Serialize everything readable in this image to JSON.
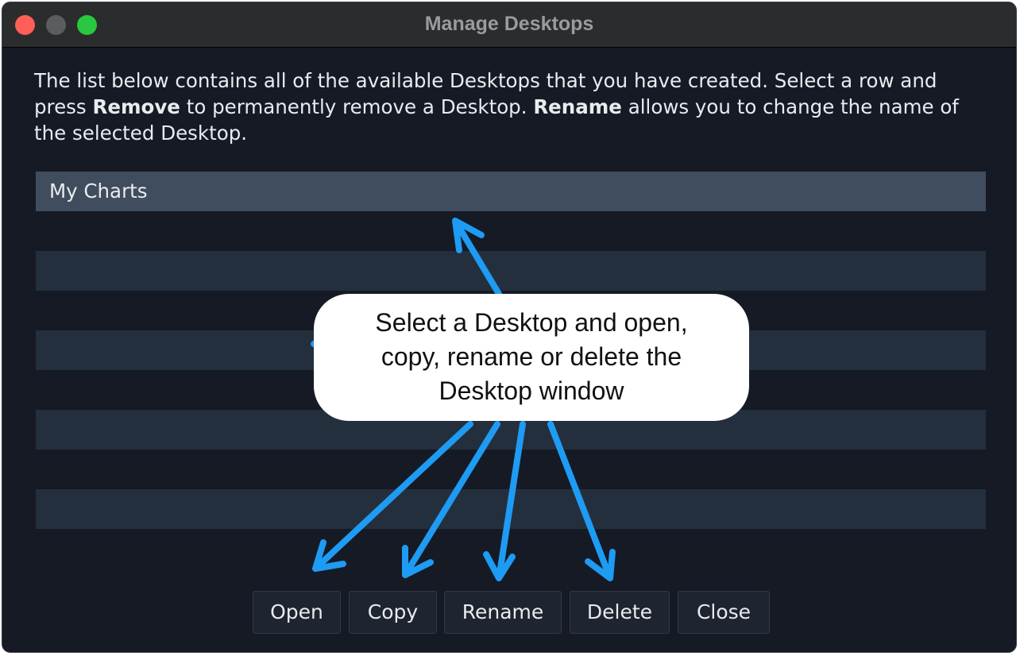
{
  "window": {
    "title": "Manage Desktops",
    "controls": {
      "close_color": "#fe5f57",
      "minimize_color": "#5b5c5e",
      "maximize_color": "#28c840"
    }
  },
  "description": {
    "part1": "The list below contains all of the available Desktops that you have created.  Select a row and press ",
    "remove_word": "Remove",
    "part2": " to permanently remove a Desktop.  ",
    "rename_word": "Rename",
    "part3": " allows you to change the name of the selected Desktop."
  },
  "desktops": {
    "rows": [
      "My Charts",
      "",
      "",
      "",
      "",
      "",
      "",
      "",
      ""
    ],
    "selected_index": 0
  },
  "buttons": {
    "open": "Open",
    "copy": "Copy",
    "rename": "Rename",
    "delete": "Delete",
    "close": "Close"
  },
  "annotation": {
    "callout_line1": "Select a Desktop and open,",
    "callout_line2": "copy, rename or delete the",
    "callout_line3": "Desktop window",
    "arrow_color": "#1e9bf3"
  }
}
